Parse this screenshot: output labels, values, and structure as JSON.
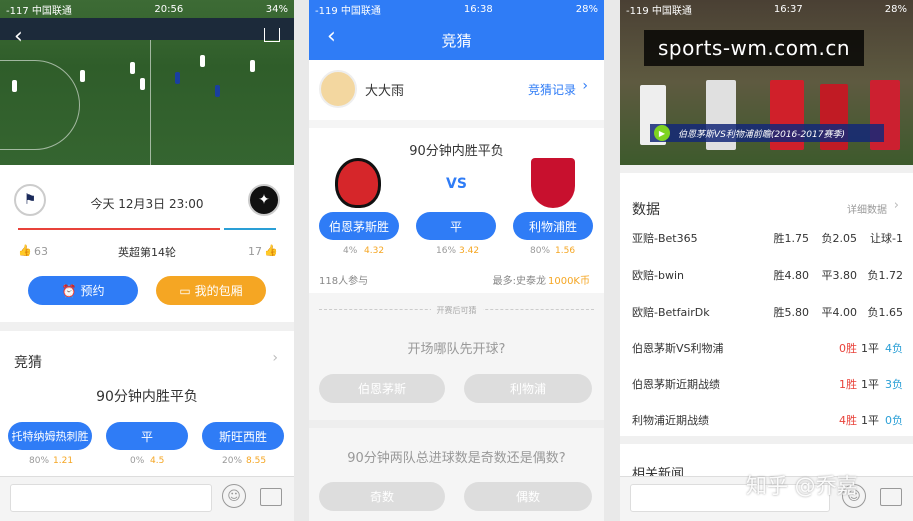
{
  "p1": {
    "status": {
      "left": "-117 中国联通",
      "time": "20:56",
      "right": "34%"
    },
    "match_time": "今天 12月3日 23:00",
    "round": "英超第14轮",
    "likes_left": "63",
    "likes_right": "17",
    "btn_reserve": "预约",
    "btn_package": "我的包厢",
    "section_title": "竞猜",
    "question": "90分钟内胜平负",
    "options": [
      {
        "label": "托特纳姆热刺胜",
        "pct": "80%",
        "odds": "1.21"
      },
      {
        "label": "平",
        "pct": "0%",
        "odds": "4.5"
      },
      {
        "label": "斯旺西胜",
        "pct": "20%",
        "odds": "8.55"
      }
    ]
  },
  "p2": {
    "status": {
      "left": "-119 中国联通",
      "time": "16:38",
      "right": "28%"
    },
    "title": "竞猜",
    "user": "大大雨",
    "record": "竞猜记录",
    "question": "90分钟内胜平负",
    "vs": "VS",
    "options": [
      {
        "label": "伯恩茅斯胜",
        "pct": "4%",
        "odds": "4.32"
      },
      {
        "label": "平",
        "pct": "16%",
        "odds": "3.42"
      },
      {
        "label": "利物浦胜",
        "pct": "80%",
        "odds": "1.56"
      }
    ],
    "participants": "118人参与",
    "top_prefix": "最多:史泰龙",
    "top_value": "1000K币",
    "after_kickoff": "开赛后可猜",
    "q2": "开场哪队先开球?",
    "q2_options": [
      "伯恩茅斯",
      "利物浦"
    ],
    "q3": "90分钟两队总进球数是奇数还是偶数?",
    "q3_options": [
      "奇数",
      "偶数"
    ]
  },
  "p3": {
    "status": {
      "left": "-119 中国联通",
      "time": "16:37",
      "right": "28%"
    },
    "watermark": "sports-wm.com.cn",
    "video_caption": "伯恩茅斯VS利物浦前瞻(2016-2017赛季)",
    "section": "数据",
    "detail": "详细数据",
    "rows": [
      {
        "name": "亚赔-Bet365",
        "v1": "胜1.75",
        "v2": "负2.05",
        "v3": "让球-1"
      },
      {
        "name": "欧赔-bwin",
        "v1": "胜4.80",
        "v2": "平3.80",
        "v3": "负1.72"
      },
      {
        "name": "欧赔-BetfairDk",
        "v1": "胜5.80",
        "v2": "平4.00",
        "v3": "负1.65"
      }
    ],
    "records": [
      {
        "name": "伯恩茅斯VS利物浦",
        "w": "0胜",
        "d": "1平",
        "l": "4负"
      },
      {
        "name": "伯恩茅斯近期战绩",
        "w": "1胜",
        "d": "1平",
        "l": "3负"
      },
      {
        "name": "利物浦近期战绩",
        "w": "4胜",
        "d": "1平",
        "l": "0负"
      }
    ],
    "related": "相关新闻",
    "zhihu": "知乎 @乔嘉"
  },
  "colors": {
    "blue": "#2f7cf6",
    "orange": "#f5a623",
    "red": "#e8423a",
    "teal": "#2a9fd6",
    "green": "#4caf50"
  }
}
